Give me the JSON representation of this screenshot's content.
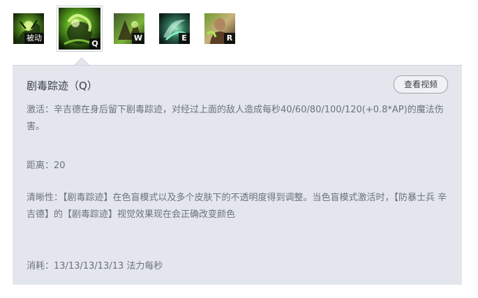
{
  "skills": [
    {
      "icon": "passive-skill-icon",
      "key": "被动"
    },
    {
      "icon": "q-skill-icon",
      "key": "Q"
    },
    {
      "icon": "w-skill-icon",
      "key": "W"
    },
    {
      "icon": "e-skill-icon",
      "key": "E"
    },
    {
      "icon": "r-skill-icon",
      "key": "R"
    }
  ],
  "panel": {
    "title": "剧毒踪迹（Q）",
    "video_button": "查看视频",
    "activation": "激活：辛吉德在身后留下剧毒踪迹，对经过上面的敌人造成每秒40/60/80/100/120(+0.8*AP)的魔法伤害。",
    "range": "距离：20",
    "clarity": "清晰性：【剧毒踪迹】在色盲模式以及多个皮肤下的不透明度得到调整。当色盲模式激活时，【防暴士兵 辛吉德】的【剧毒踪迹】视觉效果现在会正确改变颜色",
    "cost": "消耗：13/13/13/13/13 法力每秒"
  },
  "colors": {
    "panel_bg": "#e3e7ed",
    "title_text": "#3a3e45",
    "body_text": "#6d7179",
    "toxic_green": "#7fd13b"
  }
}
